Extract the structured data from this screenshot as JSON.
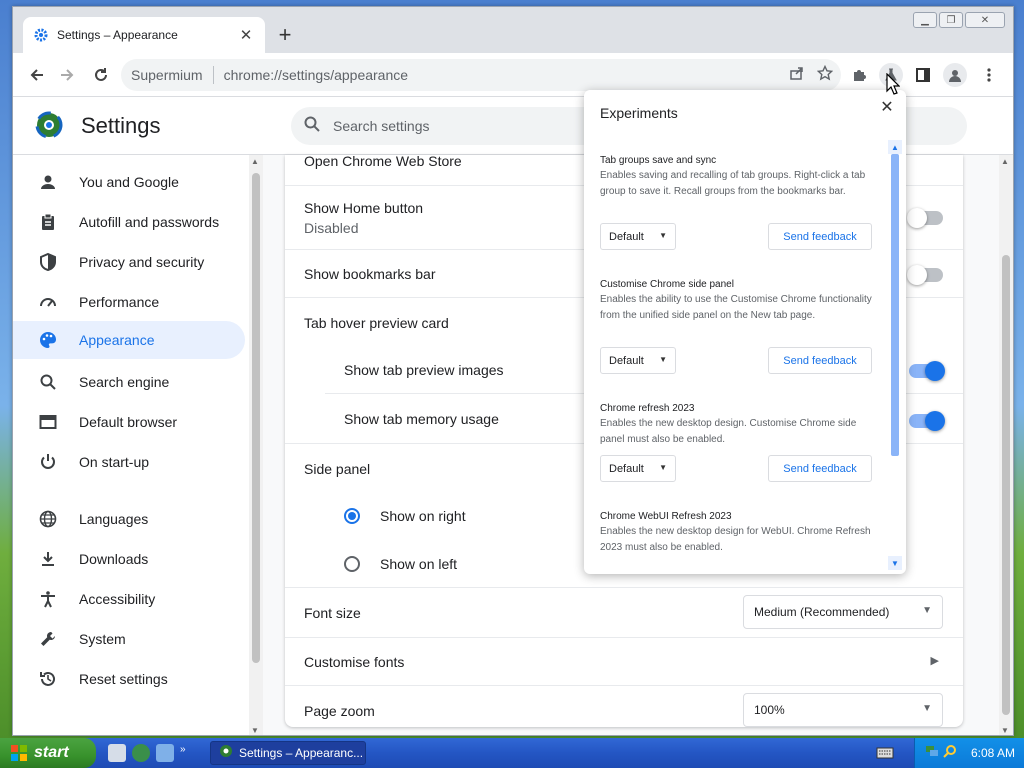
{
  "browser": {
    "tab_title": "Settings – Appearance",
    "omnibox": {
      "site": "Supermium",
      "url": "chrome://settings/appearance"
    }
  },
  "settings": {
    "title": "Settings",
    "search_placeholder": "Search settings",
    "nav": [
      {
        "label": "You and Google",
        "icon": "person-icon"
      },
      {
        "label": "Autofill and passwords",
        "icon": "clipboard-icon"
      },
      {
        "label": "Privacy and security",
        "icon": "shield-icon"
      },
      {
        "label": "Performance",
        "icon": "speedometer-icon"
      },
      {
        "label": "Appearance",
        "icon": "palette-icon",
        "active": true
      },
      {
        "label": "Search engine",
        "icon": "search-icon"
      },
      {
        "label": "Default browser",
        "icon": "browser-window-icon"
      },
      {
        "label": "On start-up",
        "icon": "power-icon"
      },
      {
        "label": "Languages",
        "icon": "globe-icon"
      },
      {
        "label": "Downloads",
        "icon": "download-icon"
      },
      {
        "label": "Accessibility",
        "icon": "accessibility-icon"
      },
      {
        "label": "System",
        "icon": "wrench-icon"
      },
      {
        "label": "Reset settings",
        "icon": "history-icon"
      }
    ],
    "appearance": {
      "web_store": "Open Chrome Web Store",
      "home_button": {
        "label": "Show Home button",
        "sub": "Disabled",
        "on": false
      },
      "bookmarks_bar": {
        "label": "Show bookmarks bar",
        "on": false
      },
      "hover_card": "Tab hover preview card",
      "preview_images": {
        "label": "Show tab preview images",
        "on": true
      },
      "memory_usage": {
        "label": "Show tab memory usage",
        "on": true
      },
      "side_panel": "Side panel",
      "show_right": "Show on right",
      "show_left": "Show on left",
      "font_size": {
        "label": "Font size",
        "value": "Medium (Recommended)"
      },
      "customise_fonts": "Customise fonts",
      "page_zoom": {
        "label": "Page zoom",
        "value": "100%"
      }
    }
  },
  "experiments": {
    "title": "Experiments",
    "default_label": "Default",
    "feedback_label": "Send feedback",
    "items": [
      {
        "title": "Tab groups save and sync",
        "desc": "Enables saving and recalling of tab groups. Right-click a tab group to save it. Recall groups from the bookmarks bar."
      },
      {
        "title": "Customise Chrome side panel",
        "desc": "Enables the ability to use the Customise Chrome functionality from the unified side panel on the New tab page."
      },
      {
        "title": "Chrome refresh 2023",
        "desc": "Enables the new desktop design. Customise Chrome side panel must also be enabled."
      },
      {
        "title": "Chrome WebUI Refresh 2023",
        "desc": "Enables the new desktop design for WebUI. Chrome Refresh 2023 must also be enabled."
      }
    ]
  },
  "taskbar": {
    "start": "start",
    "task_label": "Settings – Appearanc...",
    "clock": "6:08 AM"
  },
  "colors": {
    "accent": "#1a73e8",
    "taskbar": "#2456c4",
    "start": "#38922c"
  }
}
